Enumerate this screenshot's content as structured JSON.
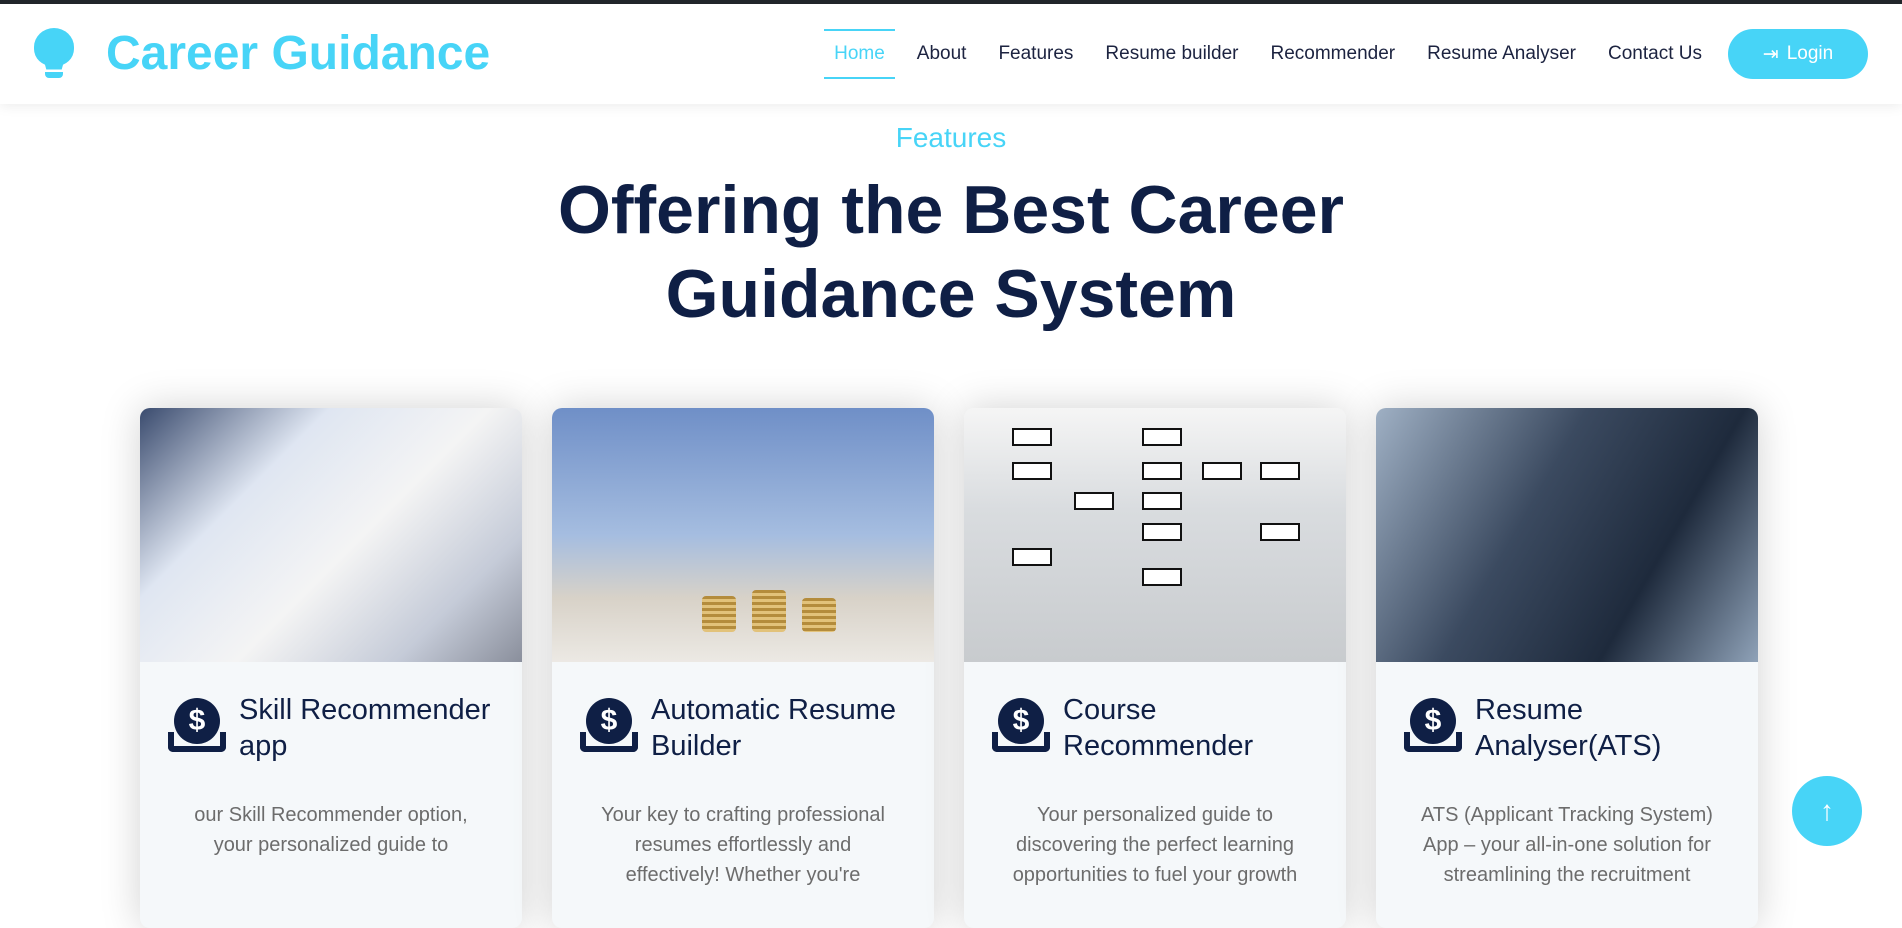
{
  "header": {
    "brand": "Career Guidance",
    "nav": [
      "Home",
      "About",
      "Features",
      "Resume builder",
      "Recommender",
      "Resume Analyser",
      "Contact Us"
    ],
    "login": "Login"
  },
  "section": {
    "subtitle": "Features",
    "title": "Offering the Best Career Guidance System"
  },
  "cards": [
    {
      "title": "Skill Recommender app",
      "desc": "our Skill Recommender option, your personalized guide to"
    },
    {
      "title": "Automatic Resume Builder",
      "desc": "Your key to crafting professional resumes effortlessly and effectively! Whether you're"
    },
    {
      "title": "Course Recommender",
      "desc": "Your personalized guide to discovering the perfect learning opportunities to fuel your growth"
    },
    {
      "title": "Resume Analyser(ATS)",
      "desc": "ATS (Applicant Tracking System) App – your all-in-one solution for streamlining the recruitment"
    }
  ],
  "colors": {
    "accent": "#47d4f7",
    "navy": "#0f1f45"
  }
}
